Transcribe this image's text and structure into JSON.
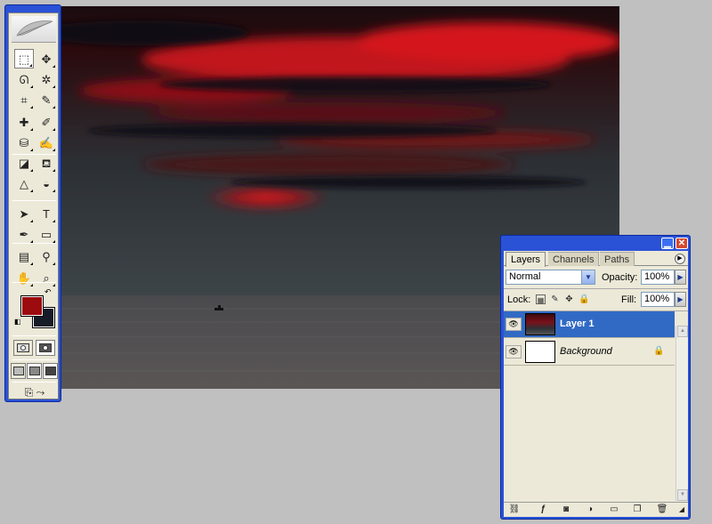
{
  "colors": {
    "foreground": "#9c0b0d",
    "background": "#161b28",
    "selected_layer": "#316ac5"
  },
  "toolbox": {
    "tools": [
      {
        "name": "rectangular-marquee-icon",
        "glyph": "⬚"
      },
      {
        "name": "move-icon",
        "glyph": "✥"
      },
      {
        "name": "lasso-icon",
        "glyph": "ᘏ"
      },
      {
        "name": "magic-wand-icon",
        "glyph": "✲"
      },
      {
        "name": "crop-icon",
        "glyph": "⌗"
      },
      {
        "name": "slice-icon",
        "glyph": "✎"
      },
      {
        "name": "healing-brush-icon",
        "glyph": "✚"
      },
      {
        "name": "brush-icon",
        "glyph": "✐"
      },
      {
        "name": "clone-stamp-icon",
        "glyph": "⛁"
      },
      {
        "name": "history-brush-icon",
        "glyph": "✍"
      },
      {
        "name": "eraser-icon",
        "glyph": "◪"
      },
      {
        "name": "paint-bucket-icon",
        "glyph": "⛾"
      },
      {
        "name": "blur-icon",
        "glyph": "△"
      },
      {
        "name": "dodge-icon",
        "glyph": "◒"
      },
      {
        "name": "path-selection-icon",
        "glyph": "➤"
      },
      {
        "name": "type-icon",
        "glyph": "T"
      },
      {
        "name": "pen-icon",
        "glyph": "✒"
      },
      {
        "name": "rectangle-shape-icon",
        "glyph": "▭"
      },
      {
        "name": "notes-icon",
        "glyph": "▤"
      },
      {
        "name": "eyedropper-icon",
        "glyph": "⚲"
      },
      {
        "name": "hand-icon",
        "glyph": "✋"
      },
      {
        "name": "zoom-icon",
        "glyph": "⌕"
      }
    ]
  },
  "layers_panel": {
    "tabs": [
      "Layers",
      "Channels",
      "Paths"
    ],
    "blend_mode": "Normal",
    "opacity_label": "Opacity:",
    "opacity_value": "100%",
    "lock_label": "Lock:",
    "fill_label": "Fill:",
    "fill_value": "100%",
    "layers": [
      {
        "name": "Layer 1",
        "selected": true
      },
      {
        "name": "Background",
        "selected": false,
        "locked": true
      }
    ],
    "footer_icons": [
      "link-icon",
      "layer-style-icon",
      "layer-mask-icon",
      "adjustment-layer-icon",
      "new-group-icon",
      "new-layer-icon",
      "delete-layer-icon"
    ]
  }
}
